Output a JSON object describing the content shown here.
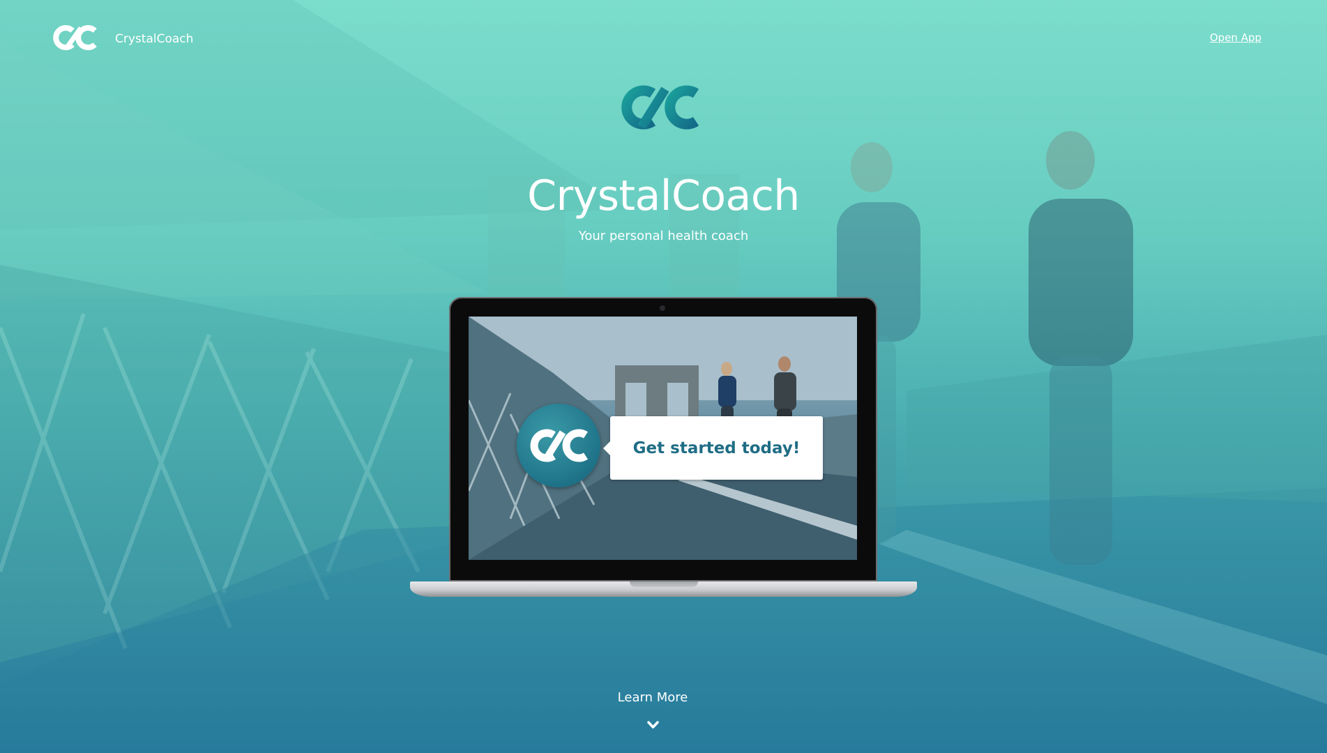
{
  "header": {
    "brand_name": "CrystalCoach",
    "open_app_label": "Open App",
    "logo_icon": "crystalcoach-logo-icon"
  },
  "hero": {
    "logo_icon": "crystalcoach-logo-icon",
    "title": "CrystalCoach",
    "subtitle": "Your personal health coach"
  },
  "laptop": {
    "screen_badge_icon": "crystalcoach-logo-icon",
    "screen_card_text": "Get started today!"
  },
  "footer": {
    "learn_more_label": "Learn More",
    "chevron_icon": "chevron-down-icon"
  },
  "colors": {
    "accent": "#1f7389",
    "background_top": "#7ddccb",
    "background_bottom": "#2b7e9c",
    "text": "#ffffff"
  }
}
